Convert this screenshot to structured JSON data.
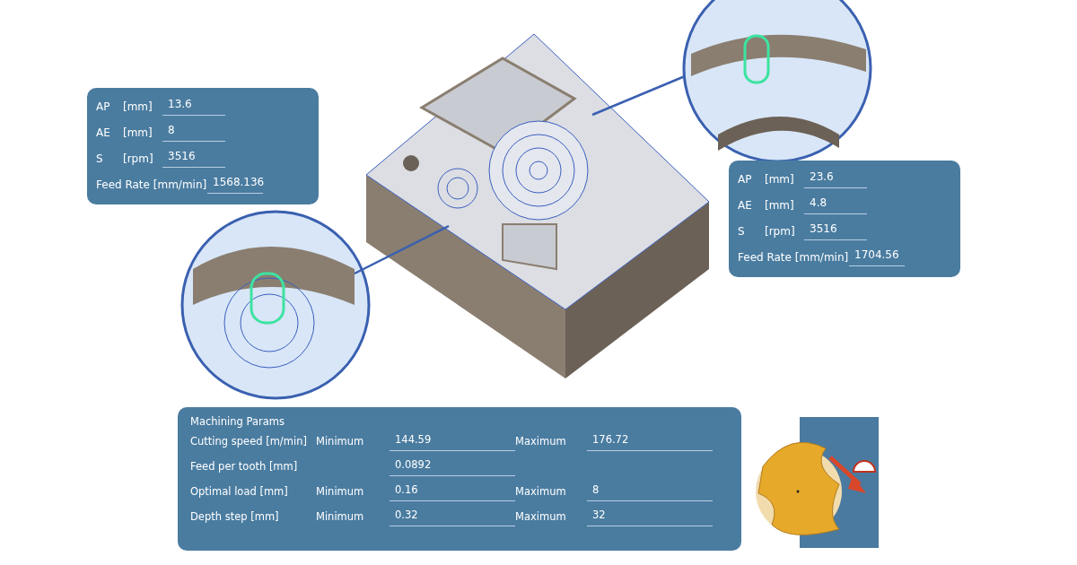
{
  "left_panel": {
    "rows": [
      {
        "label": "AP",
        "unit": "[mm]",
        "value": "13.6"
      },
      {
        "label": "AE",
        "unit": "[mm]",
        "value": "8"
      },
      {
        "label": "S",
        "unit": "[rpm]",
        "value": "3516"
      }
    ],
    "feed_rate": {
      "label": "Feed Rate [mm/min]",
      "value": "1568.136"
    }
  },
  "right_panel": {
    "rows": [
      {
        "label": "AP",
        "unit": "[mm]",
        "value": "23.6"
      },
      {
        "label": "AE",
        "unit": "[mm]",
        "value": "4.8"
      },
      {
        "label": "S",
        "unit": "[rpm]",
        "value": "3516"
      }
    ],
    "feed_rate": {
      "label": "Feed Rate [mm/min]",
      "value": "1704.56"
    }
  },
  "machining_params": {
    "title": "Machining Params",
    "rows": [
      {
        "label": "Cutting speed [m/min]",
        "min_label": "Minimum",
        "min_value": "144.59",
        "max_label": "Maximum",
        "max_value": "176.72"
      },
      {
        "label": "Feed per tooth [mm]",
        "min_value": "0.0892"
      },
      {
        "label": "Optimal load [mm]",
        "min_label": "Minimum",
        "min_value": "0.16",
        "max_label": "Maximum",
        "max_value": "8"
      },
      {
        "label": "Depth step [mm]",
        "min_label": "Minimum",
        "min_value": "0.32",
        "max_label": "Maximum",
        "max_value": "32"
      }
    ]
  }
}
